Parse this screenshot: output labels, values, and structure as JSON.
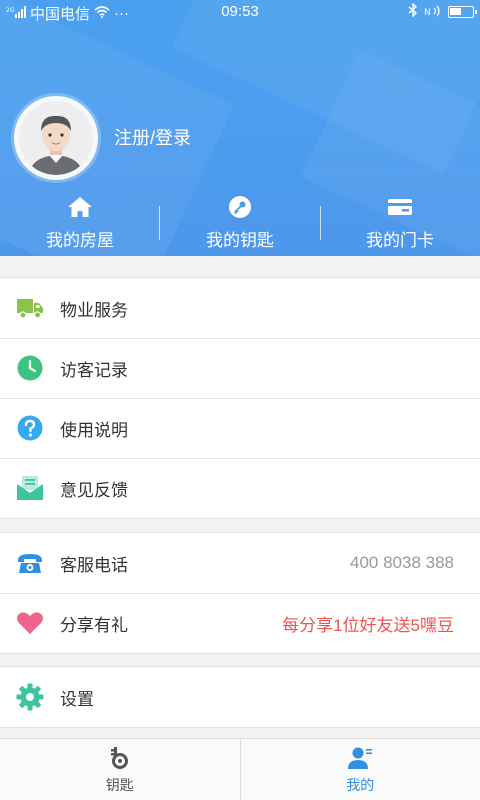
{
  "status_bar": {
    "carrier": "中国电信",
    "dots": "···",
    "time": "09:53",
    "battery_level": 0.55
  },
  "profile": {
    "login_label": "注册/登录"
  },
  "quick_actions": [
    {
      "label": "我的房屋",
      "icon": "home-icon"
    },
    {
      "label": "我的钥匙",
      "icon": "key-icon"
    },
    {
      "label": "我的门卡",
      "icon": "card-icon"
    }
  ],
  "menu_group_1": [
    {
      "label": "物业服务",
      "icon": "truck-icon",
      "color": "#8bc34a"
    },
    {
      "label": "访客记录",
      "icon": "clock-icon",
      "color": "#3cc37f"
    },
    {
      "label": "使用说明",
      "icon": "question-icon",
      "color": "#36a8ec"
    },
    {
      "label": "意见反馈",
      "icon": "mail-icon",
      "color": "#3cc3a0"
    }
  ],
  "menu_group_2": [
    {
      "label": "客服电话",
      "icon": "phone-icon",
      "value": "400 8038 388",
      "color": "#2f8fe0"
    },
    {
      "label": "分享有礼",
      "icon": "heart-icon",
      "value": "每分享1位好友送5嘿豆",
      "color": "#f0648c",
      "value_color": "#f05451"
    }
  ],
  "menu_group_3": [
    {
      "label": "设置",
      "icon": "gear-icon",
      "color": "#3cc3a0"
    }
  ],
  "tabbar": {
    "tabs": [
      {
        "label": "钥匙",
        "icon": "key-tab-icon",
        "active": false
      },
      {
        "label": "我的",
        "icon": "user-tab-icon",
        "active": true
      }
    ],
    "active_color": "#2f8fe0",
    "inactive_color": "#555555"
  }
}
